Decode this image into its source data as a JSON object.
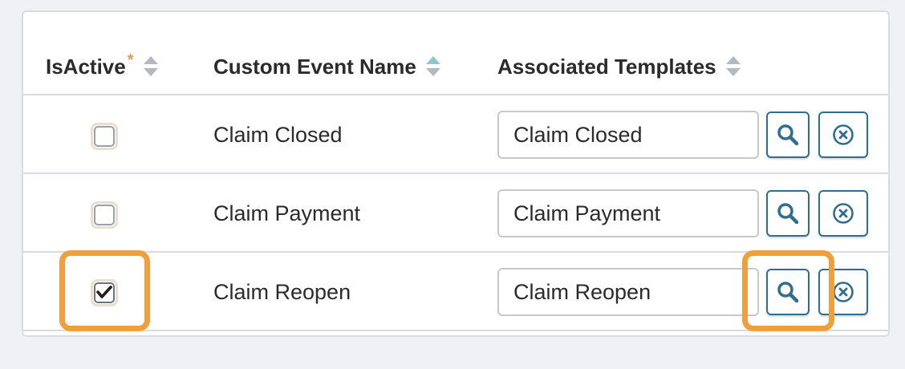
{
  "table": {
    "columns": [
      {
        "label": "IsActive",
        "required_marker": "*",
        "sort": "none"
      },
      {
        "label": "Custom Event Name",
        "sort": "ascending"
      },
      {
        "label": "Associated Templates",
        "sort": "none"
      }
    ],
    "rows": [
      {
        "is_active": false,
        "event_name": "Claim Closed",
        "template": "Claim Closed"
      },
      {
        "is_active": false,
        "event_name": "Claim Payment",
        "template": "Claim Payment"
      },
      {
        "is_active": true,
        "event_name": "Claim Reopen",
        "template": "Claim Reopen"
      }
    ]
  },
  "icons": {
    "lookup": "search-icon",
    "clear": "close-circle-icon"
  },
  "colors": {
    "button_border": "#2f6e8e",
    "highlight": "#f0a03a",
    "required": "#e39a4a",
    "sort_active": "#8ec7cc"
  }
}
